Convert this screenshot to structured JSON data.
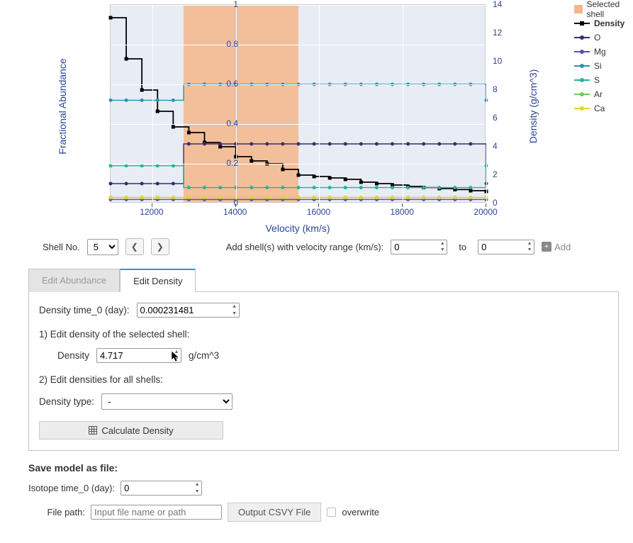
{
  "chart_data": {
    "type": "line",
    "xlabel": "Velocity (km/s)",
    "ylabel_left": "Fractional Abundance",
    "ylabel_right": "Density (g/cm^3)",
    "xlim": [
      11000,
      20000
    ],
    "ylim_left": [
      0,
      1
    ],
    "ylim_right": [
      0,
      14
    ],
    "x_ticks": [
      12000,
      14000,
      16000,
      18000,
      20000
    ],
    "y_left_ticks": [
      0,
      0.2,
      0.4,
      0.6,
      0.8,
      1
    ],
    "y_right_ticks": [
      0,
      2,
      4,
      6,
      8,
      10,
      12,
      14
    ],
    "selected_shell_range": [
      12750,
      15500
    ],
    "series": [
      {
        "name": "Density",
        "axis": "right",
        "color": "#000000",
        "style": "step-square",
        "x": [
          11000,
          11375,
          11750,
          12125,
          12500,
          12875,
          13250,
          13625,
          14000,
          14375,
          14750,
          15125,
          15500,
          15875,
          16250,
          16625,
          17000,
          17375,
          17750,
          18125,
          18500,
          18875,
          19250,
          19625,
          20000
        ],
        "y": [
          13.1,
          10.2,
          8.0,
          6.5,
          5.4,
          5.0,
          4.3,
          4.0,
          3.3,
          3.0,
          2.8,
          2.4,
          2.0,
          1.9,
          1.8,
          1.7,
          1.5,
          1.4,
          1.3,
          1.2,
          1.12,
          1.05,
          0.98,
          0.9,
          0.85
        ]
      },
      {
        "name": "O",
        "axis": "left",
        "color": "#3b2b6b",
        "style": "step-dot",
        "x": [
          11000,
          12500,
          12750,
          15500,
          20000
        ],
        "y": [
          0.1,
          0.1,
          0.3,
          0.3,
          0.1
        ]
      },
      {
        "name": "Mg",
        "axis": "left",
        "color": "#5b4ea9",
        "style": "step-dot",
        "x": [
          11000,
          12500,
          12750,
          15500,
          20000
        ],
        "y": [
          0.02,
          0.02,
          0.02,
          0.02,
          0.02
        ]
      },
      {
        "name": "Si",
        "axis": "left",
        "color": "#2f8fb5",
        "style": "step-dot",
        "x": [
          11000,
          12500,
          12750,
          15500,
          20000
        ],
        "y": [
          0.52,
          0.52,
          0.6,
          0.6,
          0.52
        ]
      },
      {
        "name": "S",
        "axis": "left",
        "color": "#26b29a",
        "style": "step-dot",
        "x": [
          11000,
          12500,
          12750,
          15500,
          20000
        ],
        "y": [
          0.19,
          0.19,
          0.08,
          0.08,
          0.19
        ]
      },
      {
        "name": "Ar",
        "axis": "left",
        "color": "#6dcb5c",
        "style": "step-dot",
        "x": [
          11000,
          20000
        ],
        "y": [
          0.03,
          0.03
        ]
      },
      {
        "name": "Ca",
        "axis": "left",
        "color": "#e5d32e",
        "style": "step-dot",
        "x": [
          11000,
          20000
        ],
        "y": [
          0.03,
          0.03
        ]
      }
    ],
    "legend_extra": {
      "selected_shell_label": "Selected shell",
      "selected_shell_color": "#f5b78a"
    }
  },
  "controls": {
    "shell_no_label": "Shell No.",
    "shell_no_value": "5",
    "add_shells_label": "Add shell(s) with velocity range (km/s):",
    "range_from": "0",
    "to_label": "to",
    "range_to": "0",
    "add_button": "Add"
  },
  "tabs": {
    "edit_abundance": "Edit Abundance",
    "edit_density": "Edit Density"
  },
  "density_panel": {
    "time0_label": "Density time_0 (day):",
    "time0_value": "0.000231481",
    "section1": "1) Edit density of the selected shell:",
    "density_label": "Density",
    "density_value": "4.717",
    "density_unit": "g/cm^3",
    "section2": "2) Edit densities for all shells:",
    "density_type_label": "Density type:",
    "density_type_value": "-",
    "calc_button": "Calculate Density"
  },
  "save": {
    "title": "Save model as file:",
    "iso_time_label": "Isotope time_0 (day):",
    "iso_time_value": "0",
    "file_path_label": "File path:",
    "file_path_placeholder": "Input file name or path",
    "output_button": "Output CSVY File",
    "overwrite_label": "overwrite"
  }
}
